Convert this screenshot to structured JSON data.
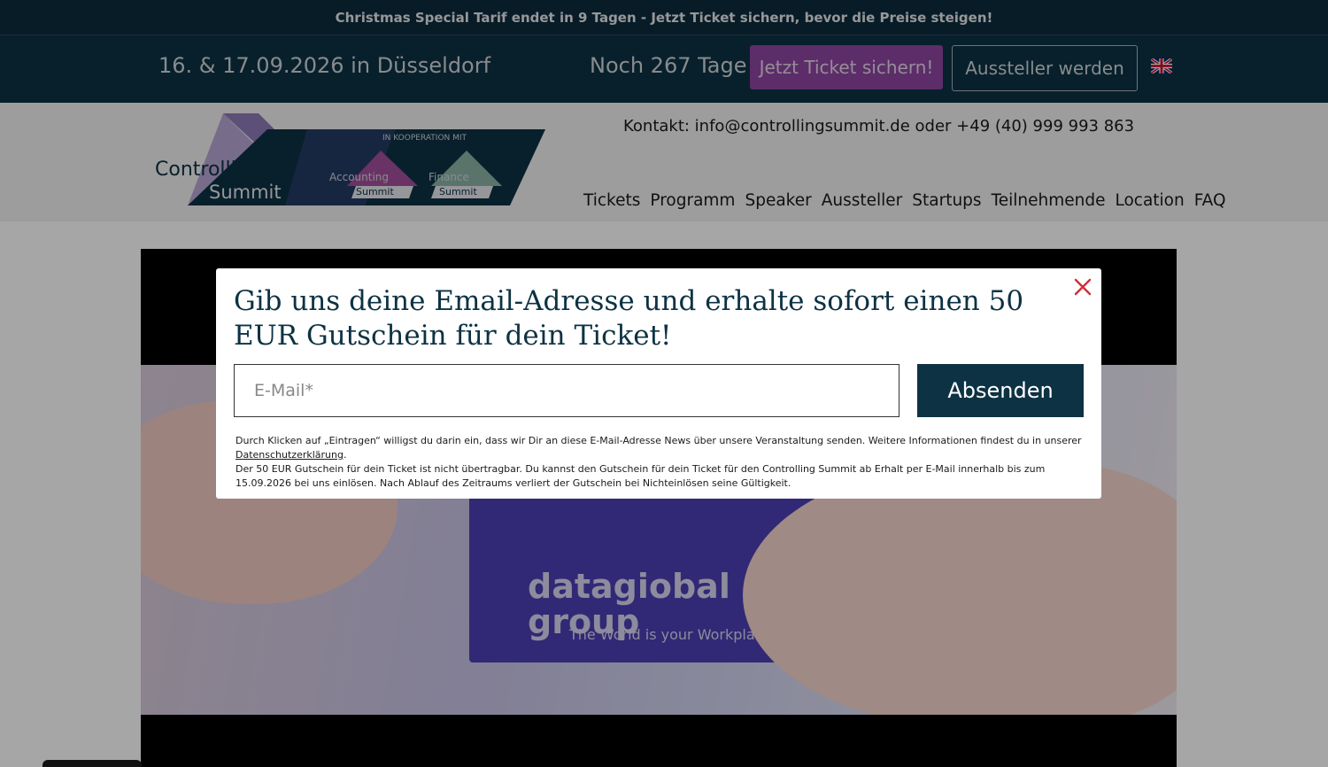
{
  "promo_bar": {
    "text": "Christmas Special Tarif endet in 9 Tagen - Jetzt Ticket sichern, bevor die Preise steigen!"
  },
  "info_bar": {
    "event_date": "16. & 17.09.2026 in Düsseldorf",
    "countdown": "Noch 267 Tage",
    "ticket_button": "Jetzt Ticket sichern!",
    "exhibitor_button": "Aussteller werden",
    "language_icon": "uk-flag-icon"
  },
  "header": {
    "logo": {
      "main_line1": "Controlling",
      "main_line2": "Summit",
      "cooperation": "IN KOOPERATION MIT",
      "partner1_line1": "Accounting",
      "partner1_line2": "Summit",
      "partner2_line1": "Finance",
      "partner2_line2": "Summit"
    },
    "contact": "Kontakt: info@controllingsummit.de oder +49 (40) 999 993 863",
    "nav": [
      "Tickets",
      "Programm",
      "Speaker",
      "Aussteller",
      "Startups",
      "Teilnehmende",
      "Location",
      "FAQ"
    ]
  },
  "video": {
    "brand": "dataglobal group",
    "brand_line1": "datagiobal",
    "brand_line2": "group",
    "tagline": "The World is your Workplace"
  },
  "modal": {
    "title": "Gib uns deine Email-Adresse und erhalte sofort einen 50 EUR Gutschein für dein Ticket!",
    "email_placeholder": "E-Mail*",
    "submit_label": "Absenden",
    "legal_part1": "Durch Klicken auf „Eintragen“ willigst du darin ein, dass wir Dir an diese E-Mail-Adresse News über unsere Veranstaltung senden. Weitere Informationen findest du in unserer ",
    "privacy_link": "Datenschutzerklärung",
    "legal_part2": ".",
    "legal_part3": "Der 50 EUR Gutschein für dein Ticket ist nicht übertragbar. Du kannst den Gutschein für dein Ticket für den Controlling Summit ab Erhalt per E-Mail innerhalb bis zum 15.09.2026 bei uns einlösen. Nach Ablauf des Zeitraums verliert der Gutschein bei Nichteinlösen seine Gültigkeit."
  },
  "colors": {
    "dark_navy": "#0d3243",
    "brand_purple": "#8e46a0",
    "close_red": "#d0313c"
  }
}
